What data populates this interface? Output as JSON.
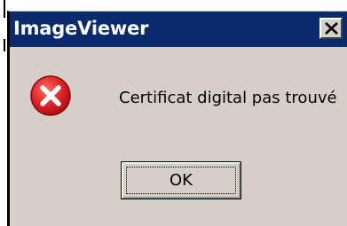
{
  "window": {
    "title": "ImageViewer",
    "titlebar_color": "#0a2a6c",
    "close_icon": "close-icon"
  },
  "dialog": {
    "icon": "error-icon",
    "icon_color": "#e0262b",
    "message": "Certificat digital pas trouvé"
  },
  "buttons": {
    "ok_label": "OK"
  }
}
